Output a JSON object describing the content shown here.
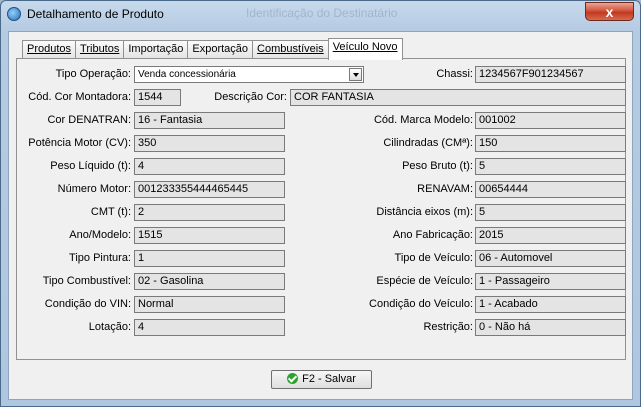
{
  "window": {
    "title": "Detalhamento de Produto",
    "background_title": "Identificação do Destinatário",
    "close_label": "x"
  },
  "tabs": [
    {
      "label": "Produtos",
      "active": false
    },
    {
      "label": "Tributos",
      "active": false
    },
    {
      "label": "Importação",
      "active": false
    },
    {
      "label": "Exportação",
      "active": false
    },
    {
      "label": "Combustíveis",
      "active": false
    },
    {
      "label": "Veículo Novo",
      "active": true
    }
  ],
  "fields": {
    "tipo_operacao": {
      "label": "Tipo Operação:",
      "value": "Venda concessionária"
    },
    "chassi": {
      "label": "Chassi:",
      "value": "1234567F901234567"
    },
    "cod_cor_montadora": {
      "label": "Cód. Cor Montadora:",
      "value": "1544"
    },
    "descricao_cor": {
      "label": "Descrição Cor:",
      "value": "COR FANTASIA"
    },
    "cor_denatran": {
      "label": "Cor DENATRAN:",
      "value": "16 - Fantasia"
    },
    "cod_marca_modelo": {
      "label": "Cód. Marca Modelo:",
      "value": "001002"
    },
    "potencia_motor": {
      "label": "Potência Motor (CV):",
      "value": "350"
    },
    "cilindradas": {
      "label": "Cilindradas (CMª):",
      "value": "150"
    },
    "peso_liquido": {
      "label": "Peso Líquido (t):",
      "value": "4"
    },
    "peso_bruto": {
      "label": "Peso Bruto (t):",
      "value": "5"
    },
    "numero_motor": {
      "label": "Número Motor:",
      "value": "001233355444465445"
    },
    "renavam": {
      "label": "RENAVAM:",
      "value": "00654444"
    },
    "cmt": {
      "label": "CMT (t):",
      "value": "2"
    },
    "distancia_eixos": {
      "label": "Distância eixos (m):",
      "value": "5"
    },
    "ano_modelo": {
      "label": "Ano/Modelo:",
      "value": "1515"
    },
    "ano_fabricacao": {
      "label": "Ano Fabricação:",
      "value": "2015"
    },
    "tipo_pintura": {
      "label": "Tipo Pintura:",
      "value": "1"
    },
    "tipo_veiculo": {
      "label": "Tipo de Veículo:",
      "value": "06 - Automovel"
    },
    "tipo_combustivel": {
      "label": "Tipo Combustível:",
      "value": "02 - Gasolina"
    },
    "especie_veiculo": {
      "label": "Espécie de Veículo:",
      "value": "1 - Passageiro"
    },
    "condicao_vin": {
      "label": "Condição do VIN:",
      "value": "Normal"
    },
    "condicao_veiculo": {
      "label": "Condição do Veículo:",
      "value": "1 - Acabado"
    },
    "lotacao": {
      "label": "Lotação:",
      "value": "4"
    },
    "restricao": {
      "label": "Restrição:",
      "value": "0 - Não há"
    }
  },
  "footer": {
    "save_label": "F2 - Salvar"
  },
  "icons": {
    "app": "car-product-icon",
    "save": "check-circle-icon"
  },
  "colors": {
    "field_bg": "#e4e4e4",
    "window_frame": "#b5cbe2",
    "close": "#c0391f"
  }
}
